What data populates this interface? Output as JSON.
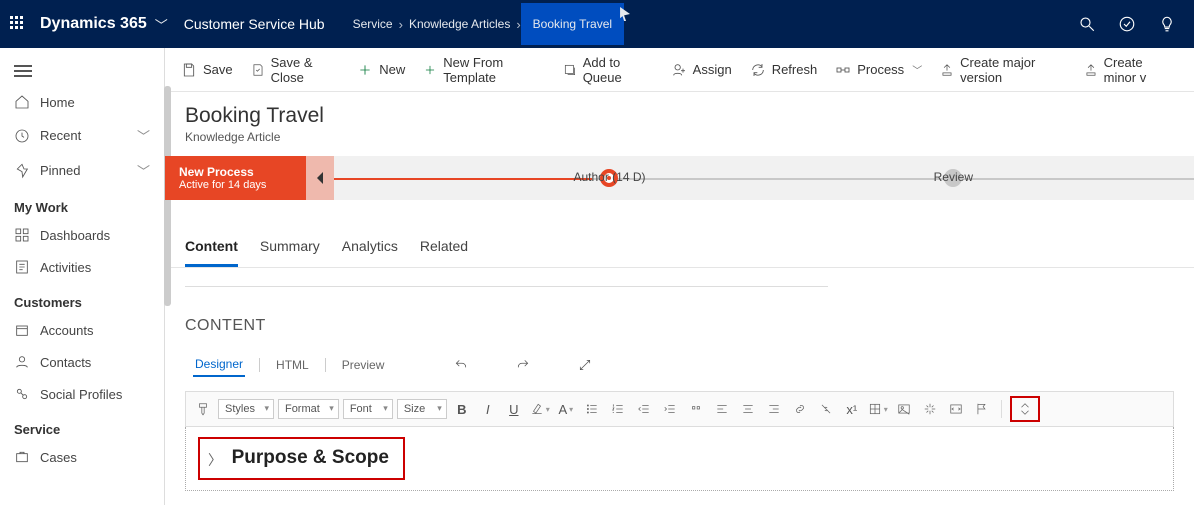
{
  "top": {
    "brand": "Dynamics 365",
    "hub": "Customer Service Hub",
    "breadcrumb": [
      "Service",
      "Knowledge Articles",
      "Booking Travel"
    ]
  },
  "sidebar": {
    "primary": [
      {
        "label": "Home"
      },
      {
        "label": "Recent",
        "expandable": true
      },
      {
        "label": "Pinned",
        "expandable": true
      }
    ],
    "groups": [
      {
        "title": "My Work",
        "items": [
          "Dashboards",
          "Activities"
        ]
      },
      {
        "title": "Customers",
        "items": [
          "Accounts",
          "Contacts",
          "Social Profiles"
        ]
      },
      {
        "title": "Service",
        "items": [
          "Cases"
        ]
      }
    ]
  },
  "commands": {
    "save": "Save",
    "saveClose": "Save & Close",
    "new": "New",
    "newTemplate": "New From Template",
    "addQueue": "Add to Queue",
    "assign": "Assign",
    "refresh": "Refresh",
    "process": "Process",
    "major": "Create major version",
    "minor": "Create minor v"
  },
  "header": {
    "title": "Booking Travel",
    "subtitle": "Knowledge Article"
  },
  "process": {
    "name": "New Process",
    "status": "Active for 14 days",
    "stages": [
      {
        "label": "Author  (14 D)",
        "active": true
      },
      {
        "label": "Review",
        "active": false
      }
    ]
  },
  "tabs": [
    "Content",
    "Summary",
    "Analytics",
    "Related"
  ],
  "content": {
    "section": "CONTENT",
    "editorTabs": [
      "Designer",
      "HTML",
      "Preview"
    ],
    "toolbar": {
      "styles": "Styles",
      "format": "Format",
      "font": "Font",
      "size": "Size"
    },
    "body": {
      "heading": "Purpose & Scope"
    }
  }
}
